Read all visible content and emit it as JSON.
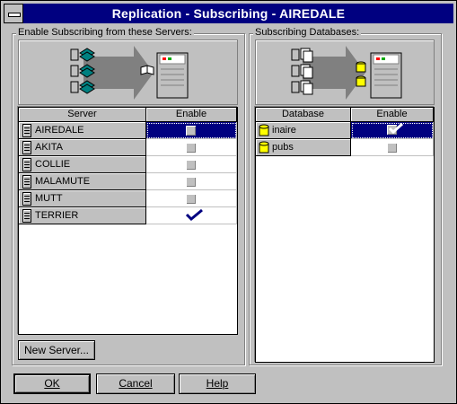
{
  "window": {
    "title": "Replication - Subscribing - AIREDALE"
  },
  "servers_group": {
    "label": "Enable Subscribing from these Servers:",
    "columns": [
      "Server",
      "Enable"
    ],
    "rows": [
      {
        "name": "AIREDALE",
        "enabled": false,
        "selected": true
      },
      {
        "name": "AKITA",
        "enabled": false
      },
      {
        "name": "COLLIE",
        "enabled": false
      },
      {
        "name": "MALAMUTE",
        "enabled": false
      },
      {
        "name": "MUTT",
        "enabled": false
      },
      {
        "name": "TERRIER",
        "enabled": true
      }
    ],
    "new_server_label": "New Server..."
  },
  "databases_group": {
    "label": "Subscribing Databases:",
    "columns": [
      "Database",
      "Enable"
    ],
    "rows": [
      {
        "name": "inaire",
        "enabled": true,
        "selected": true
      },
      {
        "name": "pubs",
        "enabled": false
      }
    ]
  },
  "buttons": {
    "ok": "OK",
    "cancel": "Cancel",
    "help": "Help"
  }
}
